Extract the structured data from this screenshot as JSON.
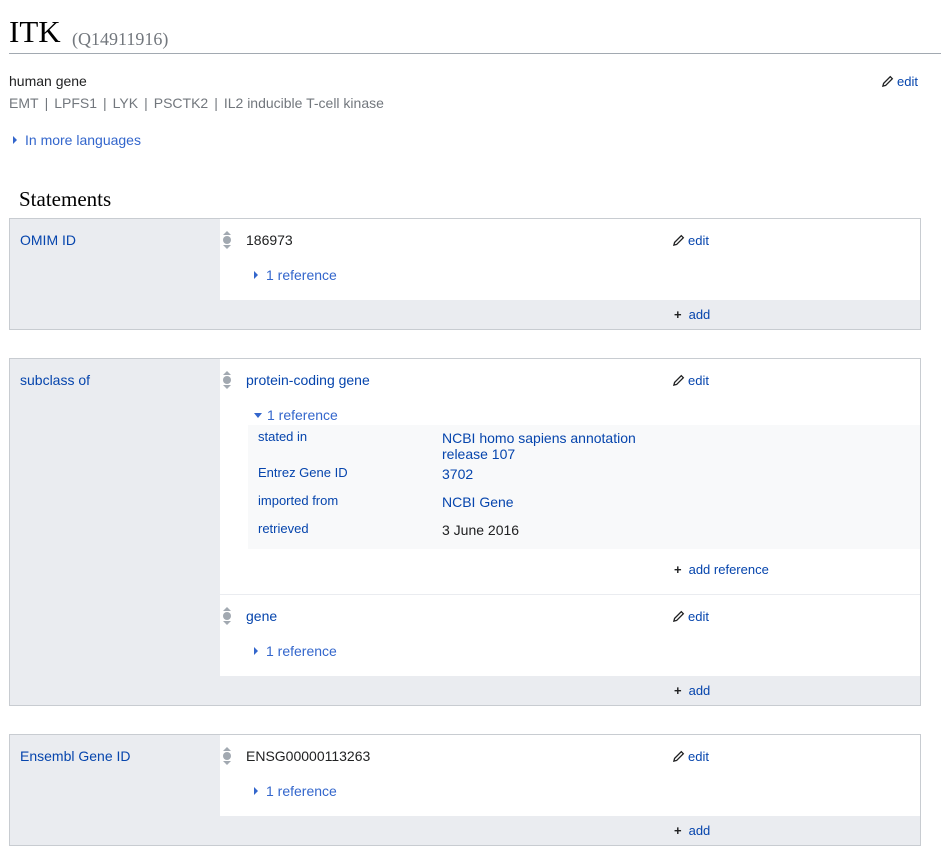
{
  "header": {
    "title": "ITK",
    "id": "(Q14911916)",
    "description": "human gene",
    "aliases": [
      "EMT",
      "LPFS1",
      "LYK",
      "PSCTK2",
      "IL2 inducible T-cell kinase"
    ],
    "edit_label": "edit",
    "more_languages": "In more languages"
  },
  "statements_heading": "Statements",
  "groups": [
    {
      "property": "OMIM ID",
      "statements": [
        {
          "value": "186973",
          "edit": "edit",
          "references": "1 reference"
        }
      ],
      "add": "add"
    },
    {
      "property": "subclass of",
      "statements": [
        {
          "value": "protein-coding gene",
          "edit": "edit",
          "references": "1 reference",
          "reference_detail": [
            {
              "prop": "stated in",
              "value": "NCBI homo sapiens annotation release 107"
            },
            {
              "prop": "Entrez Gene ID",
              "value": "3702"
            },
            {
              "prop": "imported from",
              "value": "NCBI Gene"
            },
            {
              "prop": "retrieved",
              "value": "3 June 2016"
            }
          ],
          "add_reference": "add reference"
        },
        {
          "value": "gene",
          "edit": "edit",
          "references": "1 reference"
        }
      ],
      "add": "add"
    },
    {
      "property": "Ensembl Gene ID",
      "statements": [
        {
          "value": "ENSG00000113263",
          "edit": "edit",
          "references": "1 reference"
        }
      ],
      "add": "add"
    }
  ],
  "colors": {
    "link": "#0645ad",
    "toggle": "#3366cc",
    "group_bg": "#eaecf0",
    "border": "#c8ccd1",
    "muted": "#72777d"
  },
  "icons": {
    "edit": "pencil-icon",
    "rank": "rank-normal-icon",
    "toggle": "triangle-icon",
    "add": "plus-icon"
  }
}
